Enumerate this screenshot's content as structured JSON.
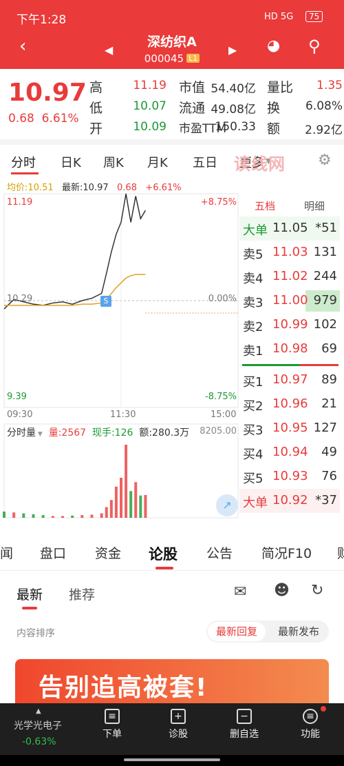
{
  "status": {
    "time": "下午1:28",
    "network": "HD 5G",
    "battery": "75"
  },
  "header": {
    "stock_name": "深纺织A",
    "code": "000045",
    "level": "L1"
  },
  "quote": {
    "price": "10.97",
    "change": "0.68",
    "change_pct": "6.61%",
    "rows": [
      {
        "k1": "高",
        "v1": "11.19",
        "k2": "市值",
        "v2": "54.40亿",
        "k3": "量比",
        "v3": "1.35"
      },
      {
        "k1": "低",
        "v1": "10.07",
        "k2": "流通",
        "v2": "49.08亿",
        "k3": "换",
        "v3": "6.08%"
      },
      {
        "k1": "开",
        "v1": "10.09",
        "k2": "市盈TTM",
        "v2": "150.33",
        "k3": "额",
        "v3": "2.92亿"
      }
    ]
  },
  "tabs": [
    "分时",
    "日K",
    "周K",
    "月K",
    "五日",
    "更多"
  ],
  "watermark": "读线网",
  "chart_info": {
    "avg_label": "均价:10.51",
    "latest_label": "最新:10.97",
    "chg": "0.68",
    "pct": "+6.61%",
    "y_top": "11.19",
    "y_mid": "10.29",
    "y_bot": "9.39",
    "pct_top": "+8.75%",
    "pct_mid": "0.00%",
    "pct_bot": "-8.75%",
    "t_start": "09:30",
    "t_mid": "11:30",
    "t_end": "15:00",
    "marker": "S"
  },
  "volume_info": {
    "label": "分时量",
    "vol": "量:2567",
    "hand": "现手:126",
    "amount": "额:280.3万",
    "vmax": "8205.00"
  },
  "book": {
    "tab1": "五档",
    "tab2": "明细",
    "rows": [
      {
        "k": "大单",
        "p": "11.05",
        "q": "*51"
      },
      {
        "k": "卖5",
        "p": "11.03",
        "q": "131"
      },
      {
        "k": "卖4",
        "p": "11.02",
        "q": "244"
      },
      {
        "k": "卖3",
        "p": "11.00",
        "q": "979"
      },
      {
        "k": "卖2",
        "p": "10.99",
        "q": "102"
      },
      {
        "k": "卖1",
        "p": "10.98",
        "q": "69"
      },
      {
        "k": "买1",
        "p": "10.97",
        "q": "89"
      },
      {
        "k": "买2",
        "p": "10.96",
        "q": "21"
      },
      {
        "k": "买3",
        "p": "10.95",
        "q": "127"
      },
      {
        "k": "买4",
        "p": "10.94",
        "q": "49"
      },
      {
        "k": "买5",
        "p": "10.93",
        "q": "76"
      },
      {
        "k": "大单",
        "p": "10.92",
        "q": "*37"
      }
    ]
  },
  "subtabs": [
    "闻",
    "盘口",
    "资金",
    "论股",
    "公告",
    "简况F10",
    "财"
  ],
  "news": {
    "tab_latest": "最新",
    "tab_recommend": "推荐",
    "sort_label": "内容排序",
    "sort_reply": "最新回复",
    "sort_publish": "最新发布",
    "banner": "告别追高被套!"
  },
  "bottom": {
    "index_name": "光学光电子",
    "index_pct": "-0.63%",
    "buy": "下单",
    "diagnose": "诊股",
    "remove": "删自选",
    "functions": "功能"
  },
  "chart_data": {
    "type": "line",
    "x": [
      "09:30",
      "09:40",
      "09:50",
      "10:00",
      "10:10",
      "10:20",
      "10:30",
      "10:40",
      "10:50",
      "11:00",
      "11:10",
      "11:15",
      "11:20",
      "11:25",
      "11:30",
      "13:05",
      "13:10",
      "13:15",
      "13:20",
      "13:25"
    ],
    "series": [
      {
        "values": [
          10.22,
          10.3,
          10.28,
          10.26,
          10.25,
          10.27,
          10.28,
          10.26,
          10.29,
          10.31,
          10.35,
          10.52,
          10.7,
          10.85,
          10.95,
          11.19,
          10.95,
          11.17,
          10.98,
          11.05
        ]
      },
      {
        "values": [
          10.25,
          10.25,
          10.25,
          10.25,
          10.25,
          10.25,
          10.25,
          10.25,
          10.26,
          10.26,
          10.27,
          10.3,
          10.35,
          10.4,
          10.44,
          10.48,
          10.5,
          10.51,
          10.51,
          10.51
        ]
      }
    ],
    "ylim": [
      9.39,
      11.19
    ],
    "volume": [
      700,
      600,
      500,
      400,
      300,
      200,
      200,
      250,
      300,
      350,
      500,
      1200,
      2000,
      3500,
      4500,
      8205,
      3000,
      4000,
      2500,
      2567
    ]
  }
}
